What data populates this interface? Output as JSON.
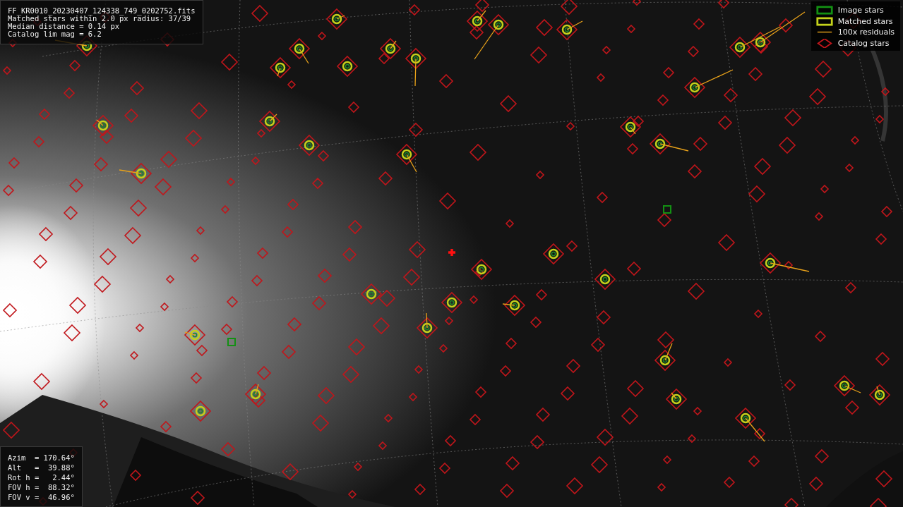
{
  "info_panel": {
    "lines": [
      "FF_KR0010_20230407_124338_749_0202752.fits",
      "Matched stars within 2.0 px radius: 37/39",
      "Median distance = 0.14 px",
      "Catalog lim mag = 6.2"
    ]
  },
  "legend": [
    {
      "label": "Image stars"
    },
    {
      "kind": "matched",
      "label": "Matched stars"
    },
    {
      "kind": "residual",
      "label": "100x residuals"
    },
    {
      "kind": "catalog",
      "label": "Catalog stars"
    }
  ],
  "pointing_panel": {
    "lines": [
      "Azim  = 170.64°",
      "Alt   =  39.88°",
      "Rot h =   2.44°",
      "FOV h =  88.32°",
      "FOV v =  46.96°"
    ]
  }
}
